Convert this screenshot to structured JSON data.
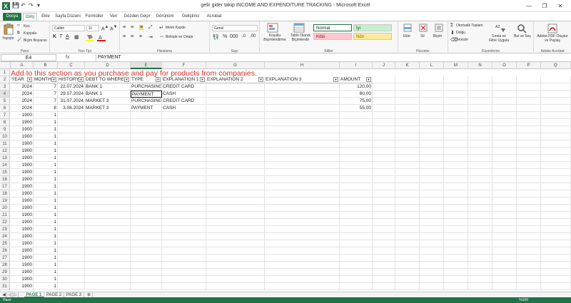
{
  "window": {
    "title": "gelir gider takip INCOME AND EXPENDITURE TRACKING - Microsoft Excel",
    "minimize": "—",
    "restore": "❐",
    "close": "✕"
  },
  "tabs": [
    "Dosya",
    "Giriş",
    "Ekle",
    "Sayfa Düzeni",
    "Formüller",
    "Veri",
    "Gözden Geçir",
    "Görünüm",
    "Geliştirici",
    "Acrobat"
  ],
  "ribbon": {
    "clipboard": {
      "paste": "Yapıştır",
      "cut": "Kes",
      "copy": "Kopyala",
      "format_painter": "Biçim Boyacısı",
      "label": "Pano"
    },
    "font": {
      "name": "Calibri",
      "size": "11",
      "label": "Yazı Tipi"
    },
    "alignment": {
      "wrap": "Metni Kaydır",
      "merge": "Birleştir ve Ortala",
      "label": "Hizalama"
    },
    "number": {
      "format": "Genel",
      "label": "Sayı"
    },
    "styles": {
      "conditional": "Koşullu Biçimlendirme",
      "table": "Tablo Olarak Biçimlendir",
      "normal": "Normal",
      "good": "İyi",
      "bad": "Kötü",
      "neutral": "Nötr",
      "label": "Stiller"
    },
    "cells": {
      "insert": "Ekle",
      "delete": "Sil",
      "format": "Biçim",
      "label": "Hücreler"
    },
    "editing": {
      "autosum": "Otomatik Toplam",
      "fill": "Dolgu",
      "clear": "Temizle",
      "sort": "Sırala ve Filtre Uygula",
      "find": "Bul ve Seç",
      "label": "Düzenleme"
    },
    "acrobat": {
      "create": "Adobe PDF Oluştur ve Paylaş",
      "label": "Adobe Acrobat"
    }
  },
  "formula_bar": {
    "name_box": "E4",
    "fx": "fx",
    "value": "PAYMENT"
  },
  "columns": [
    "A",
    "B",
    "C",
    "D",
    "E",
    "F",
    "G",
    "H",
    "I",
    "J",
    "K",
    "L",
    "M",
    "N",
    "O",
    "P",
    "Q"
  ],
  "selected_column": "E",
  "selected_row": 4,
  "banner": "Add to this section as you purchase and pay for products from companies.",
  "headers": [
    "YEAR",
    "MONTH",
    "HISTORY",
    "DEBT TO WHERE",
    "TYPE",
    "EXPLANATION 1",
    "EXPLANATION 2",
    "EXPLANATION 3",
    "AMOUNT"
  ],
  "rows": [
    {
      "year": "2024",
      "month": "7",
      "history": "22.07.2024",
      "debt": "BANK 1",
      "type": "PURCHASING",
      "exp1": "CREDIT CARD",
      "amount": "120,00"
    },
    {
      "year": "2024",
      "month": "7",
      "history": "29.07.2024",
      "debt": "BANK 1",
      "type": "PAYMENT",
      "exp1": "CASH",
      "amount": "80,00"
    },
    {
      "year": "2024",
      "month": "7",
      "history": "31.07.2024",
      "debt": "MARKET 3",
      "type": "PURCHASING",
      "exp1": "CREDIT CARD",
      "amount": "75,00"
    },
    {
      "year": "2024",
      "month": "8",
      "history": "3.08.2024",
      "debt": "MARKET 3",
      "type": "PAYMENT",
      "exp1": "CASH",
      "amount": "55,00"
    }
  ],
  "filler": {
    "year": "1900",
    "month": "1"
  },
  "row_numbers": [
    "1",
    "2",
    "3",
    "4",
    "5",
    "6",
    "7",
    "8",
    "9",
    "10",
    "11",
    "12",
    "13",
    "14",
    "15",
    "16",
    "17",
    "18",
    "19",
    "20",
    "21",
    "22",
    "23",
    "24",
    "25",
    "26",
    "27",
    "28",
    "29",
    "30",
    "31"
  ],
  "sheets": [
    "PAGE 1",
    "PAGE 2",
    "PAGE 3"
  ],
  "active_sheet": "PAGE 1",
  "status": {
    "ready": "Hazır",
    "zoom": "%100"
  },
  "colors": {
    "excel_green": "#217346",
    "banner_red": "#d9302b"
  }
}
